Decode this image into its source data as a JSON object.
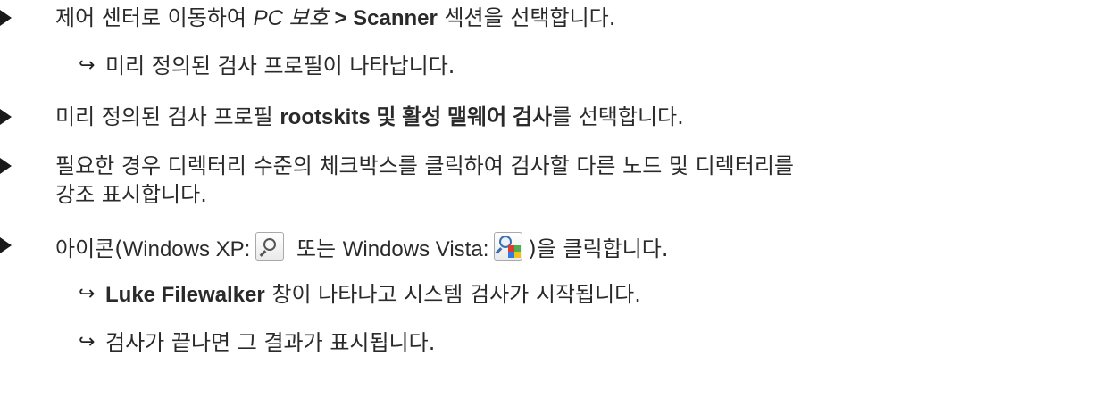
{
  "items": [
    {
      "type": "bullet",
      "parts": [
        "제어 센터로 이동하여 ",
        "PC 보호",
        " > Scanner",
        " 섹션을 선택합니다."
      ]
    },
    {
      "type": "result",
      "text": "미리 정의된 검사 프로필이 나타납니다."
    },
    {
      "type": "bullet",
      "parts": [
        "미리 정의된 검사 프로필 ",
        "rootskits 및 활성 맬웨어 검사",
        "를 선택합니다."
      ]
    },
    {
      "type": "bullet",
      "lines": [
        "필요한 경우 디렉터리 수준의 체크박스를 클릭하여 검사할 다른 노드 및 디렉터리를",
        "강조 표시합니다."
      ]
    },
    {
      "type": "bullet",
      "parts": [
        "아이콘(",
        "Windows XP:",
        " 또는 ",
        "Windows Vista:",
        ")을 클릭합니다."
      ],
      "icons": [
        "magnifier-icon",
        "vista-magnifier-icon"
      ]
    },
    {
      "type": "result",
      "parts": [
        "Luke Filewalker",
        " 창이 나타나고 시스템 검사가 시작됩니다."
      ]
    },
    {
      "type": "result",
      "text": "검사가 끝나면 그 결과가 표시됩니다."
    }
  ],
  "result_arrow": "↪",
  "colors": {
    "text": "#2a2a2a",
    "bullet": "#1a1a1a",
    "vista_quad": [
      "#e23b2e",
      "#4caf50",
      "#2f7be0",
      "#f2c21b"
    ]
  }
}
